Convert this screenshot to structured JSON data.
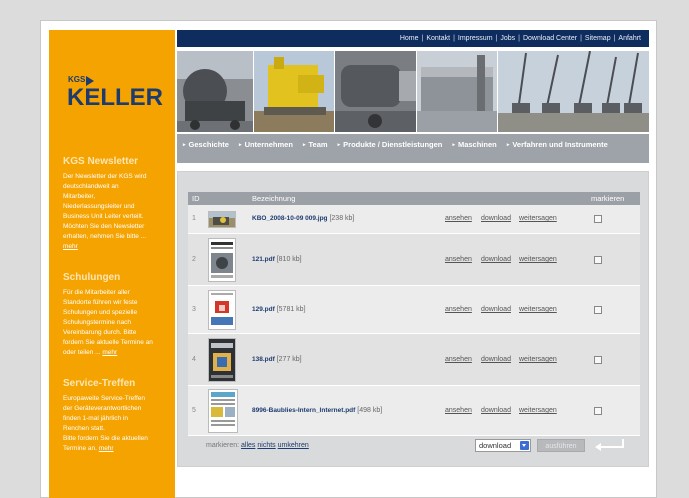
{
  "topnav": {
    "links": [
      "Home",
      "Kontakt",
      "Impressum",
      "Jobs",
      "Download Center",
      "Sitemap",
      "Anfahrt"
    ]
  },
  "logo": {
    "small": "KGS",
    "main": "KELLER"
  },
  "mainnav": {
    "items": [
      "Geschichte",
      "Unternehmen",
      "Team",
      "Produkte / Dienstleistungen",
      "Maschinen",
      "Verfahren und Instrumente"
    ]
  },
  "sidebar": {
    "newsletter": {
      "title": "KGS Newsletter",
      "lines": [
        "Der Newsletter der KGS wird",
        "deutschlandweit an",
        "Mitarbeiter,",
        "Niederlassungsleiter und",
        "Business Unit Leiter verteilt.",
        "Möchten Sie den Newsletter",
        "erhalten, nehmen Sie bitte ..."
      ],
      "more": "mehr"
    },
    "schulungen": {
      "title": "Schulungen",
      "lines": [
        "Für die Mitarbeiter aller",
        "Standorte führen wir feste",
        "Schulungen und spezielle",
        "Schulungstermine nach",
        "Vereinbarung durch. Bitte",
        "fordern Sie aktuelle Termine an"
      ],
      "last_line": "oder teilen ...",
      "more": "mehr"
    },
    "service": {
      "title": "Service-Treffen",
      "lines": [
        "Europaweite Service-Treffen",
        "der Geräteverantwortlichen",
        "finden 1-mal jährlich in",
        "Renchen statt.",
        "Bitte fordern Sie die aktuellen"
      ],
      "last_line": "Termine an.",
      "more": "mehr"
    }
  },
  "table": {
    "headers": {
      "id": "ID",
      "name": "Bezeichnung",
      "mark": "markieren"
    },
    "rows": [
      {
        "id": "1",
        "file": "KBO_2008-10-09 009.jpg",
        "size": "[238 kb]",
        "view": "ansehen",
        "download": "download",
        "share": "weitersagen"
      },
      {
        "id": "2",
        "file": "121.pdf",
        "size": "[810 kb]",
        "view": "ansehen",
        "download": "download",
        "share": "weitersagen"
      },
      {
        "id": "3",
        "file": "129.pdf",
        "size": "[5781 kb]",
        "view": "ansehen",
        "download": "download",
        "share": "weitersagen"
      },
      {
        "id": "4",
        "file": "138.pdf",
        "size": "[277 kb]",
        "view": "ansehen",
        "download": "download",
        "share": "weitersagen"
      },
      {
        "id": "5",
        "file": "8996-Baublies-Intern_Internet.pdf",
        "size": "[498 kb]",
        "view": "ansehen",
        "download": "download",
        "share": "weitersagen"
      }
    ],
    "footer": {
      "label": "markieren:",
      "all": "alles",
      "none": "nichts",
      "invert": "umkehren",
      "select_value": "download",
      "execute": "ausführen"
    }
  },
  "colors": {
    "accent": "#f5a300",
    "navy": "#0e2d5e",
    "link": "#1d3b6e"
  }
}
